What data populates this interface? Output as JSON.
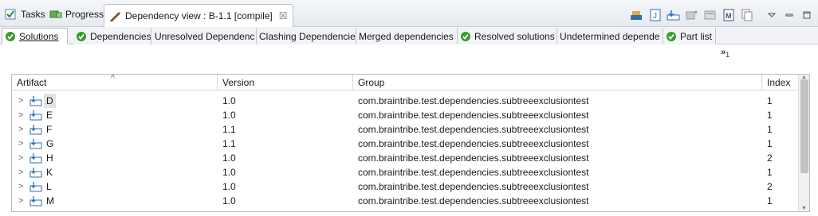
{
  "view_tabs": [
    {
      "label": "Tasks",
      "icon": "tasks-icon"
    },
    {
      "label": "Progress",
      "icon": "progress-icon"
    },
    {
      "label": "Dependency view : B-1.1 [compile]",
      "icon": "dependency-view-icon",
      "close": "☒",
      "active": true
    }
  ],
  "toolbar_icons": [
    "import-icon",
    "javadoc-icon",
    "download-icon",
    "filter-icon",
    "repository-icon",
    "maven-icon",
    "copy-icon"
  ],
  "window_controls": [
    "view-menu-icon",
    "minimize-icon",
    "maximize-icon"
  ],
  "sub_tabs": [
    {
      "label": "Solutions",
      "ok": true,
      "active": true
    },
    {
      "label": "Dependencies",
      "ok": true
    },
    {
      "label": "Unresolved Dependenc",
      "ok": false
    },
    {
      "label": "Clashing Dependencie",
      "ok": false
    },
    {
      "label": "Merged dependencies",
      "ok": false
    },
    {
      "label": "Resolved solutions",
      "ok": true
    },
    {
      "label": "Undetermined depende",
      "ok": false
    },
    {
      "label": "Part list",
      "ok": true
    }
  ],
  "overflow": {
    "chevron": "»",
    "count": "1"
  },
  "table": {
    "columns": [
      "Artifact",
      "Version",
      "Group",
      "Index"
    ],
    "sort_indicator": "^",
    "rows": [
      {
        "artifact": "D",
        "version": "1.0",
        "group": "com.braintribe.test.dependencies.subtreeexclusiontest",
        "index": "1",
        "selected": true
      },
      {
        "artifact": "E",
        "version": "1.0",
        "group": "com.braintribe.test.dependencies.subtreeexclusiontest",
        "index": "1"
      },
      {
        "artifact": "F",
        "version": "1.1",
        "group": "com.braintribe.test.dependencies.subtreeexclusiontest",
        "index": "1"
      },
      {
        "artifact": "G",
        "version": "1.1",
        "group": "com.braintribe.test.dependencies.subtreeexclusiontest",
        "index": "1"
      },
      {
        "artifact": "H",
        "version": "1.0",
        "group": "com.braintribe.test.dependencies.subtreeexclusiontest",
        "index": "2"
      },
      {
        "artifact": "K",
        "version": "1.0",
        "group": "com.braintribe.test.dependencies.subtreeexclusiontest",
        "index": "1"
      },
      {
        "artifact": "L",
        "version": "1.0",
        "group": "com.braintribe.test.dependencies.subtreeexclusiontest",
        "index": "2"
      },
      {
        "artifact": "M",
        "version": "1.0",
        "group": "com.braintribe.test.dependencies.subtreeexclusiontest",
        "index": "1"
      }
    ]
  },
  "colors": {
    "ok_green": "#3a9a2d",
    "accent_blue": "#2f6db5",
    "selection": "#e3e3e3"
  }
}
